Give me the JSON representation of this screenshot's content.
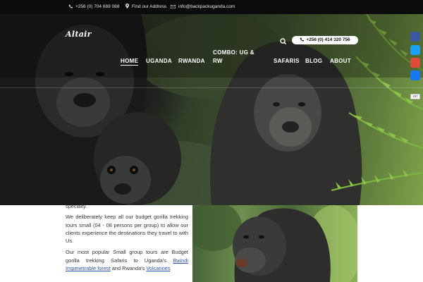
{
  "topbar": {
    "phone": "+256 (0) 704 669 088",
    "address": "Find our Address",
    "email": "info@backpackuganda.com"
  },
  "header": {
    "logo": "Altair",
    "phone_pill": "+256 (0) 414 320 756"
  },
  "nav": {
    "home": "HOME",
    "uganda": "UGANDA",
    "rwanda": "RWANDA",
    "combo": "COMBO: UG & RW",
    "safaris": "SAFARIS",
    "blog": "BLOG",
    "about": "ABOUT"
  },
  "share": {
    "count": "157",
    "colors": [
      "#3b5998",
      "#1da1f2",
      "#dd4b39",
      "#1877f2"
    ]
  },
  "content": {
    "line0": "specialty.",
    "p1": "We deliberately keep all our budget gorilla trekking tours small (04 - 08 persons per group) to allow our clients experience the destinations they travel to with Us.",
    "p2_start": "Our most popular Small group tours are Budget gorilla trekking Safaris to Uganda's ",
    "p2_link1": "Bwindi Impenetrable forest",
    "p2_mid": " and Rwanda's ",
    "p2_link2": "Volcanoes"
  }
}
